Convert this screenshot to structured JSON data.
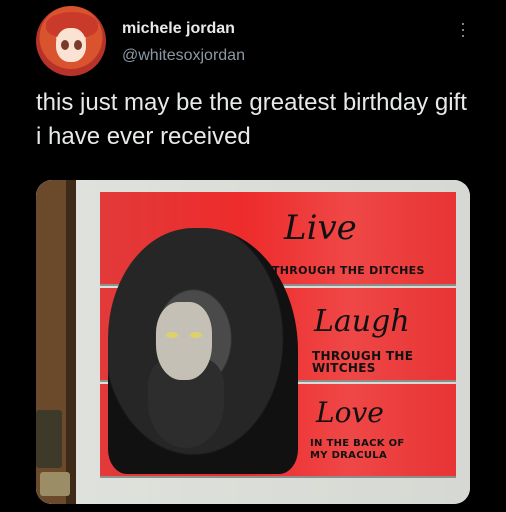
{
  "tweet": {
    "author_name": "michele jordan",
    "author_handle": "@whitesoxjordan",
    "text": "this just may be the greatest birthday gift i have ever received"
  },
  "painting": {
    "line1_script": "Live",
    "line1_caps": "THROUGH THE DITCHES",
    "line2_script": "Laugh",
    "line2_caps": "THROUGH THE WITCHES",
    "line3_script": "Love",
    "line3_caps": "IN THE BACK OF MY DRACULA"
  },
  "icons": {
    "more": "more-options-icon",
    "avatar": "avatar"
  },
  "colors": {
    "background": "#000000",
    "text_primary": "#e7e9ea",
    "text_secondary": "#8b98a5",
    "painting_red": "#ee2b2b"
  }
}
